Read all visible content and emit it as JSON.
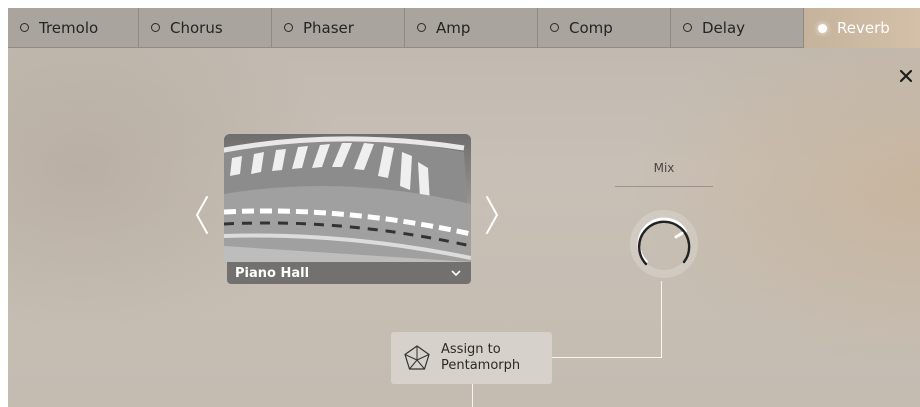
{
  "tabs": [
    {
      "label": "Tremolo",
      "active": false
    },
    {
      "label": "Chorus",
      "active": false
    },
    {
      "label": "Phaser",
      "active": false
    },
    {
      "label": "Amp",
      "active": false
    },
    {
      "label": "Comp",
      "active": false
    },
    {
      "label": "Delay",
      "active": false
    },
    {
      "label": "Reverb",
      "active": true
    }
  ],
  "close_icon": "close-icon",
  "preset": {
    "name": "Piano Hall",
    "prev_icon": "chevron-left-icon",
    "next_icon": "chevron-right-icon",
    "dropdown_icon": "chevron-down-icon"
  },
  "mix": {
    "label": "Mix",
    "value_fraction": 0.72
  },
  "assign": {
    "line1": "Assign to",
    "line2": "Pentamorph",
    "icon": "pentagon-icon"
  },
  "colors": {
    "tab_bg": "#a9a49d",
    "active_tab": "#cfbba3",
    "preset_bar": "#737170"
  }
}
